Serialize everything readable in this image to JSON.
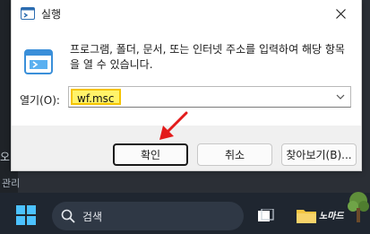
{
  "dialog": {
    "title": "실행",
    "description": "프로그램, 폴더, 문서, 또는 인터넷 주소를 입력하여 해당 항목을 열 수 있습니다.",
    "open_label": "열기(O):",
    "input_value": "wf.msc",
    "buttons": {
      "ok": "확인",
      "cancel": "취소",
      "browse": "찾아보기(B)..."
    }
  },
  "taskbar": {
    "search_placeholder": "검색",
    "brand_text": "노마드"
  },
  "background": {
    "left_char": "오",
    "left_text": "관리"
  },
  "colors": {
    "highlight": "#fff36a",
    "highlight_border": "#f5c400",
    "arrow": "#e31b1b",
    "taskbar": "#1f2630"
  }
}
